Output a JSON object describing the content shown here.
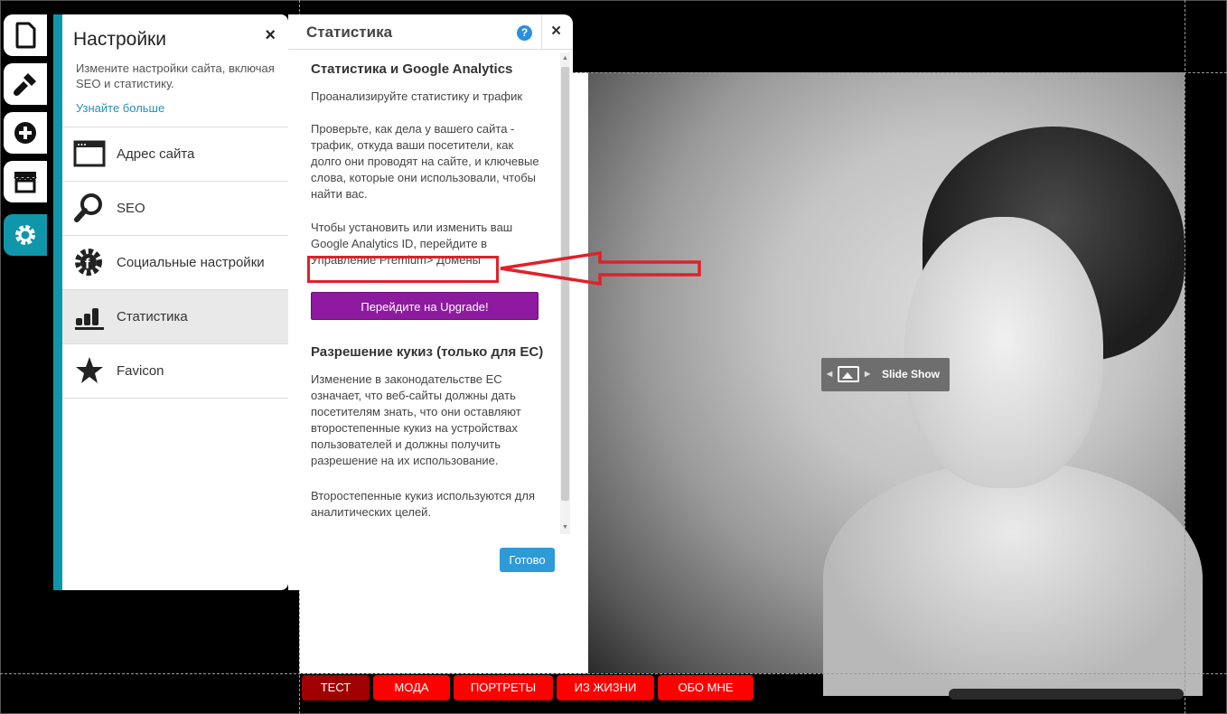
{
  "rail": {
    "buttons": [
      {
        "icon": "page-icon"
      },
      {
        "icon": "brush-icon"
      },
      {
        "icon": "plus-icon"
      },
      {
        "icon": "store-icon"
      },
      {
        "icon": "gear-icon",
        "active": true
      }
    ]
  },
  "settings": {
    "title": "Настройки",
    "description": "Измените настройки сайта, включая SEO и статистику.",
    "learn_more": "Узнайте больше",
    "items": [
      {
        "label": "Адрес сайта",
        "icon": "browser-window-icon"
      },
      {
        "label": "SEO",
        "icon": "magnifier-icon"
      },
      {
        "label": "Социальные настройки",
        "icon": "social-gear-icon"
      },
      {
        "label": "Статистика",
        "icon": "bar-chart-icon",
        "active": true
      },
      {
        "label": "Favicon",
        "icon": "star-icon"
      }
    ]
  },
  "stats": {
    "title": "Статистика",
    "help": "?",
    "close": "×",
    "heading1": "Статистика и Google Analytics",
    "p1": "Проанализируйте статистику и трафик",
    "p2": "Проверьте, как дела у вашего сайта - трафик, откуда ваши посетители, как долго они проводят на сайте, и ключевые слова, которые они использовали, чтобы найти вас.",
    "p3_line1": "Чтобы установить или изменить ваш",
    "p3_line2": "Google Analytics ID, перейдите в",
    "p3_line3": "Управление Premium> Домены",
    "upgrade_button": "Перейдите на Upgrade!",
    "heading2": "Разрешение кукиз (только для ЕС)",
    "p4": "Изменение в законодательстве ЕС означает, что веб-сайты должны дать посетителям знать, что они оставляют второстепенные кукиз на устройствах пользователей и должны получить разрешение на их использование.",
    "p5": "Второстепенные кукиз используются для аналитических целей.",
    "done_button": "Готово"
  },
  "settings_close": "×",
  "slideshow": {
    "label": "Slide Show"
  },
  "nav": [
    {
      "label": "ТЕСТ",
      "active": true
    },
    {
      "label": "МОДА"
    },
    {
      "label": "ПОРТРЕТЫ"
    },
    {
      "label": "ИЗ ЖИЗНИ"
    },
    {
      "label": "ОБО МНЕ"
    }
  ],
  "colors": {
    "accent": "#1096ab",
    "upgrade": "#8e1aa0",
    "done": "#2e9ad6",
    "nav_red": "#ff0000",
    "annotation_red": "#e1202a"
  }
}
